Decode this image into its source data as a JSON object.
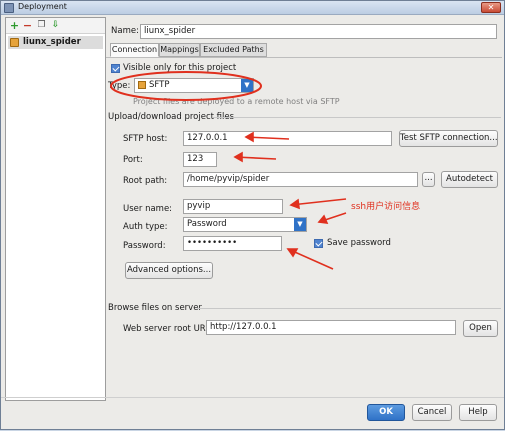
{
  "window": {
    "title": "Deployment",
    "close_glyph": "✕"
  },
  "toolbar": {
    "add_glyph": "+",
    "remove_glyph": "−",
    "copy_glyph": "❐",
    "move_glyph": "⇩"
  },
  "servers": [
    {
      "label": "liunx_spider"
    }
  ],
  "name": {
    "label": "Name:",
    "value": "liunx_spider"
  },
  "tabs": [
    {
      "label": "Connection"
    },
    {
      "label": "Mappings"
    },
    {
      "label": "Excluded Paths"
    }
  ],
  "connection": {
    "visible_only": "Visible only for this project",
    "type_label": "Type:",
    "type_value": "SFTP",
    "type_note": "Project files are deployed to a remote host via SFTP",
    "upload_group": "Upload/download project files",
    "sftp_host_label": "SFTP host:",
    "sftp_host_value": "127.0.0.1",
    "test_button": "Test SFTP connection...",
    "port_label": "Port:",
    "port_value": "123",
    "root_path_label": "Root path:",
    "root_path_value": "/home/pyvip/spider",
    "browse_button": "...",
    "autodetect_button": "Autodetect",
    "user_name_label": "User name:",
    "user_name_value": "pyvip",
    "auth_type_label": "Auth type:",
    "auth_type_value": "Password",
    "password_label": "Password:",
    "password_value": "••••••••••",
    "save_password_label": "Save password",
    "advanced_button": "Advanced options...",
    "browse_group": "Browse files on server",
    "web_root_label": "Web server root URL:",
    "web_root_value": "http://127.0.0.1",
    "open_button": "Open"
  },
  "annotation": {
    "ssh_text": "ssh用户访问信息",
    "color": "#e0301e"
  },
  "footer": {
    "ok": "OK",
    "cancel": "Cancel",
    "help": "Help"
  },
  "colors": {
    "accent": "#2f72c7",
    "window_bg": "#ecebe8"
  }
}
